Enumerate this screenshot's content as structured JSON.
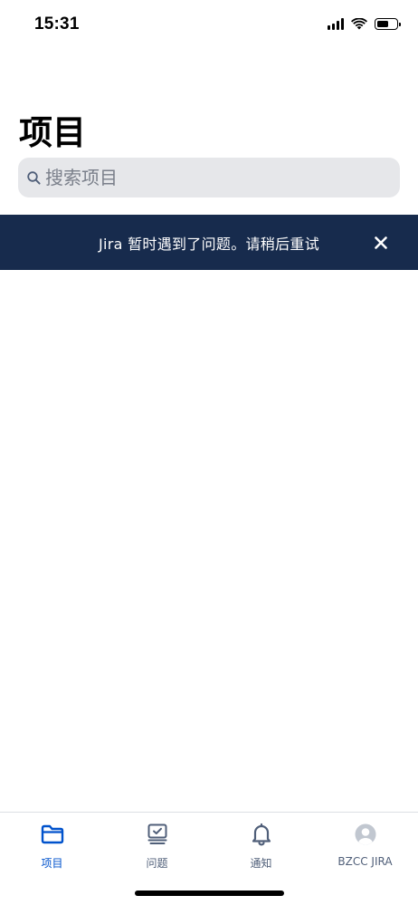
{
  "status_bar": {
    "time": "15:31"
  },
  "page": {
    "title": "项目"
  },
  "search": {
    "placeholder": "搜索项目",
    "value": ""
  },
  "banner": {
    "message": "Jira 暂时遇到了问题。请稍后重试",
    "close_icon": "close-icon",
    "background": "#172b4d"
  },
  "tab_bar": {
    "tabs": [
      {
        "label": "项目",
        "icon": "folder-icon",
        "active": true
      },
      {
        "label": "问题",
        "icon": "issues-icon",
        "active": false
      },
      {
        "label": "通知",
        "icon": "bell-icon",
        "active": false
      },
      {
        "label": "BZCC JIRA",
        "icon": "avatar-icon",
        "active": false
      }
    ],
    "active_color": "#0052cc",
    "inactive_color": "#505f79"
  }
}
